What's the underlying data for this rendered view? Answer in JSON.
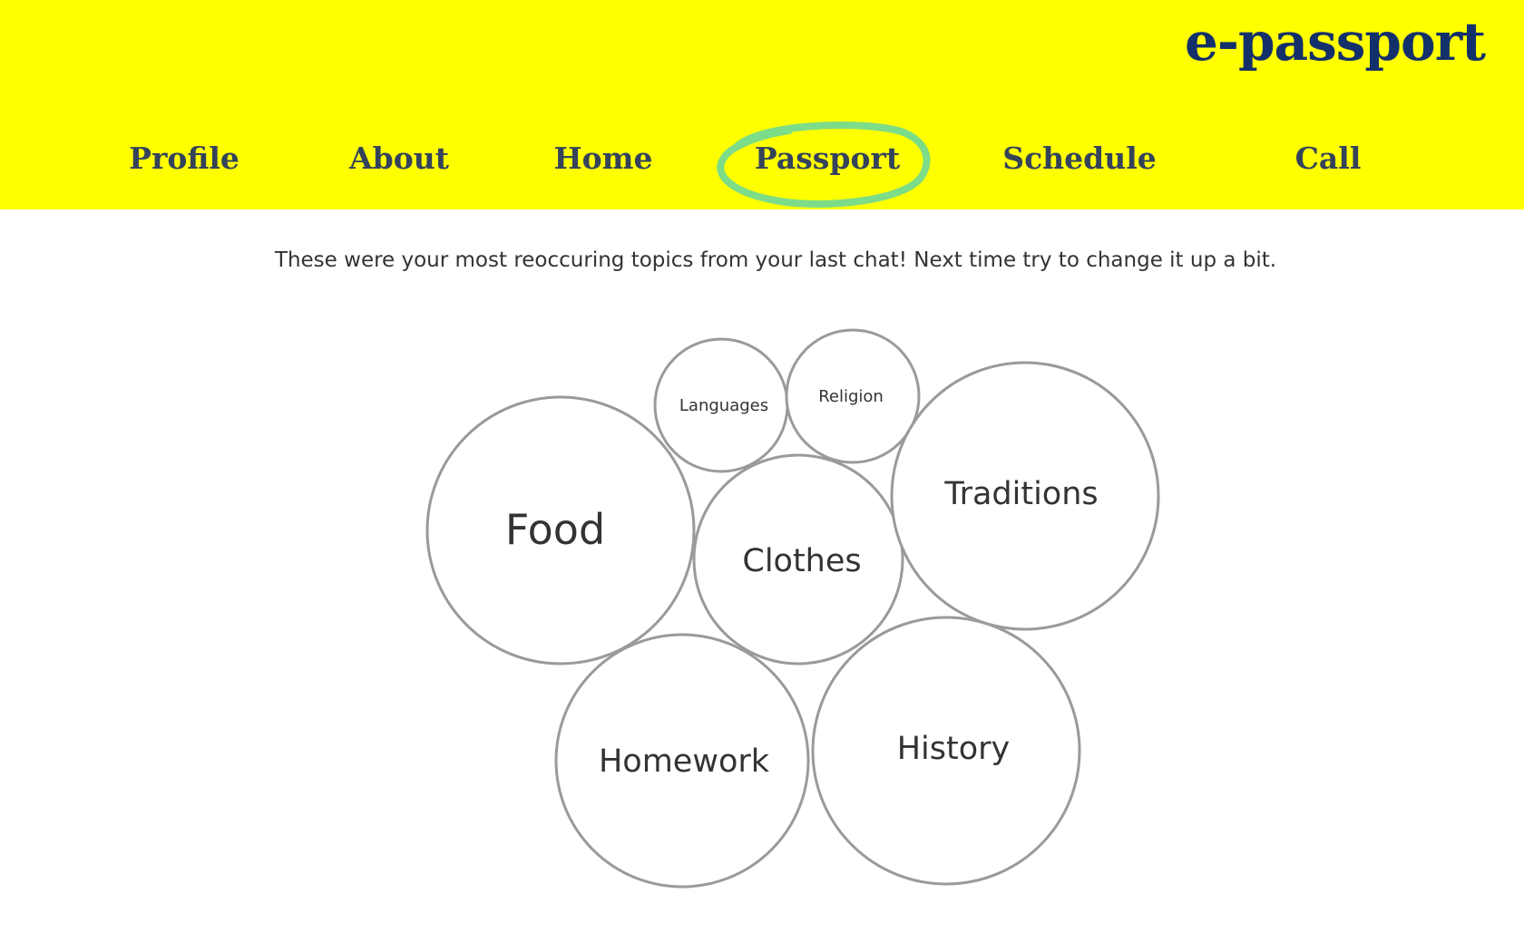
{
  "app": {
    "logo": "e-passport"
  },
  "nav": {
    "items": [
      {
        "label": "Profile"
      },
      {
        "label": "About"
      },
      {
        "label": "Home"
      },
      {
        "label": "Passport",
        "active": true
      },
      {
        "label": "Schedule"
      },
      {
        "label": "Call"
      }
    ],
    "active_highlight_color": "#7ddc88"
  },
  "colors": {
    "header_bg": "#ffff00",
    "logo": "#14306a",
    "nav_text": "#34435a",
    "body_text": "#333333",
    "bubble_stroke": "#9a9a9a"
  },
  "main": {
    "intro": "These were your most reoccuring topics from your last chat! Next time try to change it up a bit."
  },
  "chart_data": {
    "type": "bubble",
    "topics": [
      {
        "label": "Languages"
      },
      {
        "label": "Religion"
      },
      {
        "label": "Food"
      },
      {
        "label": "Clothes"
      },
      {
        "label": "Traditions"
      },
      {
        "label": "Homework"
      },
      {
        "label": "History"
      }
    ]
  }
}
